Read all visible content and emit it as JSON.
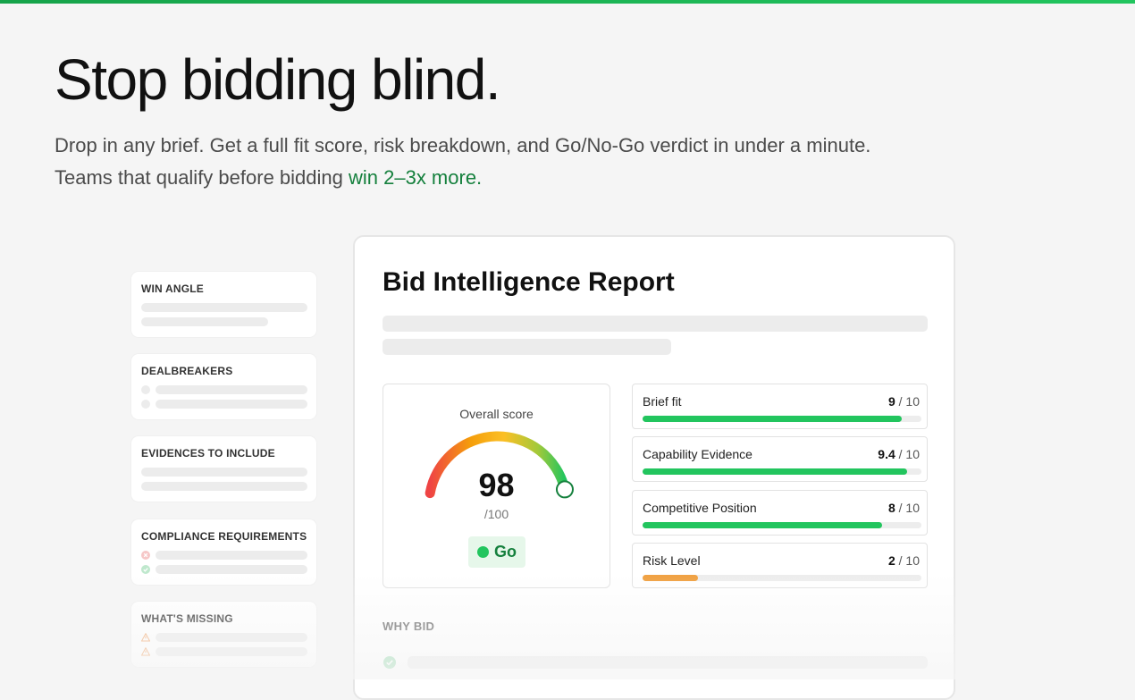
{
  "hero": {
    "title": "Stop bidding blind.",
    "subtitle_line1": "Drop in any brief. Get a full fit score, risk breakdown, and Go/No-Go verdict in under a minute.",
    "subtitle_line2_prefix": "Teams that qualify before bidding ",
    "subtitle_line2_accent": "win 2–3x more."
  },
  "sidebar": {
    "cards": [
      {
        "label": "WIN ANGLE"
      },
      {
        "label": "DEALBREAKERS"
      },
      {
        "label": "EVIDENCES TO INCLUDE"
      },
      {
        "label": "COMPLIANCE REQUIREMENTS"
      },
      {
        "label": "WHAT'S MISSING"
      }
    ]
  },
  "report": {
    "title": "Bid Intelligence Report",
    "overall": {
      "caption": "Overall score",
      "score": "98",
      "max": "/100",
      "score_value": 98,
      "verdict": "Go"
    },
    "metrics": [
      {
        "label": "Brief fit",
        "value": "9",
        "max": "/ 10",
        "ratio": 0.93,
        "color": "#22c55e"
      },
      {
        "label": "Capability Evidence",
        "value": "9.4",
        "max": "/ 10",
        "ratio": 0.95,
        "color": "#22c55e"
      },
      {
        "label": "Competitive Position",
        "value": "8",
        "max": "/ 10",
        "ratio": 0.86,
        "color": "#22c55e"
      },
      {
        "label": "Risk Level",
        "value": "2",
        "max": "/ 10",
        "ratio": 0.2,
        "color": "#f0a040"
      }
    ],
    "why_label": "WHY BID"
  },
  "colors": {
    "accent": "#15803d",
    "go_green": "#22c55e",
    "risk_orange": "#f0a040"
  }
}
